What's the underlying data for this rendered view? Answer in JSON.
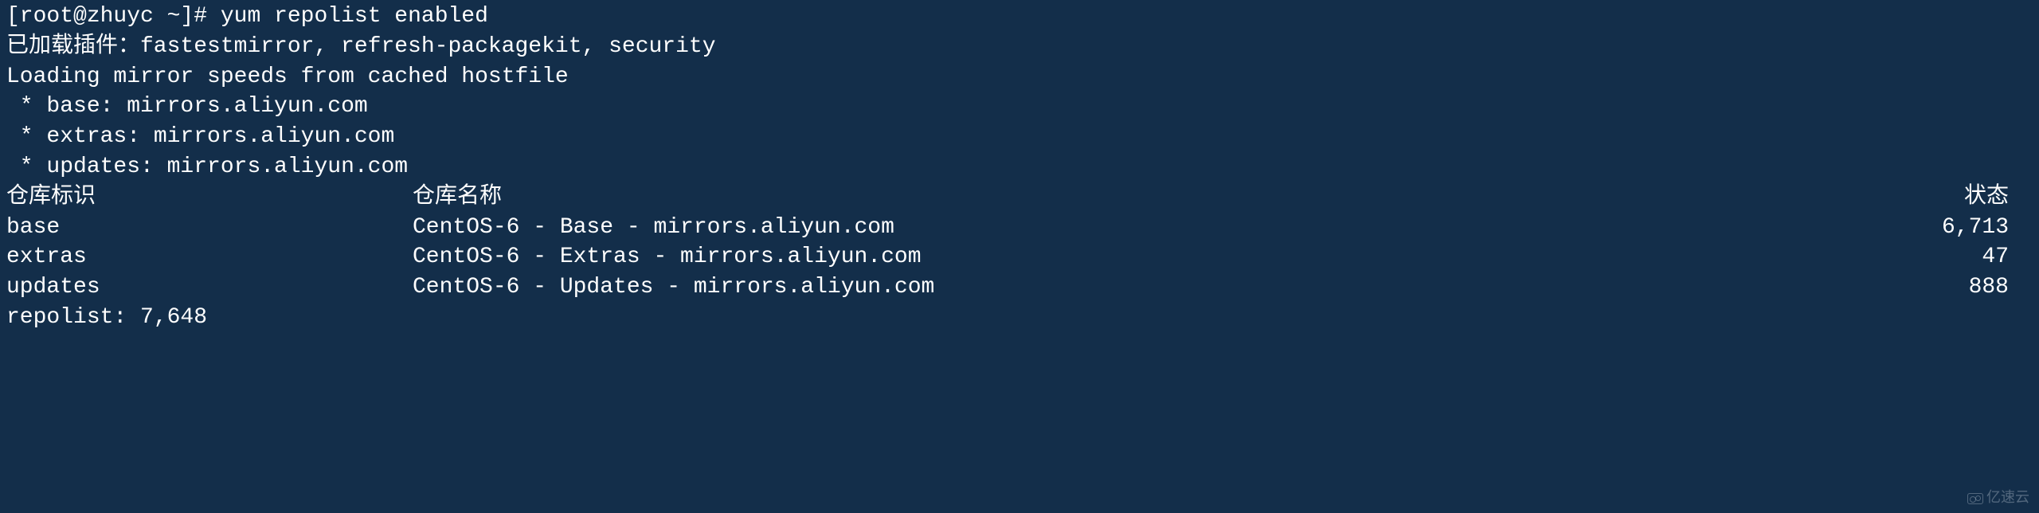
{
  "prompt": {
    "user_host": "[root@zhuyc ~]#",
    "command": "yum repolist enabled"
  },
  "output": {
    "plugins_line": "已加载插件：fastestmirror, refresh-packagekit, security",
    "loading_line": "Loading mirror speeds from cached hostfile",
    "mirrors": [
      " * base: mirrors.aliyun.com",
      " * extras: mirrors.aliyun.com",
      " * updates: mirrors.aliyun.com"
    ],
    "headers": {
      "id": "仓库标识",
      "name": "仓库名称",
      "status": "状态"
    },
    "repos": [
      {
        "id": "base",
        "name": "CentOS-6 - Base - mirrors.aliyun.com",
        "status": "6,713"
      },
      {
        "id": "extras",
        "name": "CentOS-6 - Extras - mirrors.aliyun.com",
        "status": "47"
      },
      {
        "id": "updates",
        "name": "CentOS-6 - Updates - mirrors.aliyun.com",
        "status": "888"
      }
    ],
    "total_line": "repolist: 7,648"
  },
  "watermark": "亿速云"
}
